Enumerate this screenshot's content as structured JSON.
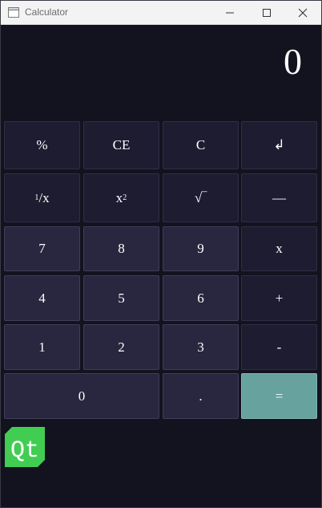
{
  "window": {
    "title": "Calculator",
    "icons": {
      "app": "calculator-app-icon",
      "minimize": "minimize-icon",
      "maximize": "maximize-icon",
      "close": "close-icon"
    }
  },
  "display": {
    "value": "0"
  },
  "keys": {
    "percent": "%",
    "clear_entry": "CE",
    "clear": "C",
    "backspace": "↲",
    "reciprocal_num": "1",
    "reciprocal_den": "/x",
    "square_base": "x",
    "square_exp": "2",
    "sqrt": "√‾",
    "divide": "—",
    "seven": "7",
    "eight": "8",
    "nine": "9",
    "multiply": "x",
    "four": "4",
    "five": "5",
    "six": "6",
    "plus": "+",
    "one": "1",
    "two": "2",
    "three": "3",
    "minus": "-",
    "zero": "0",
    "decimal": ".",
    "equals": "="
  },
  "logo": {
    "text": "Qt",
    "color": "#41cd52"
  },
  "colors": {
    "background": "#13121f",
    "operator_key": "#1d1c31",
    "digit_key": "#28273f",
    "equals_key": "#67a29f"
  }
}
